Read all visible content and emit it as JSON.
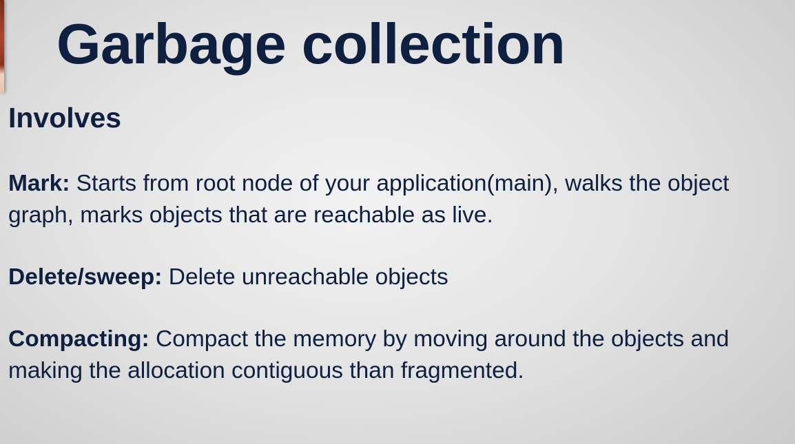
{
  "slide": {
    "title": "Garbage collection",
    "subtitle": "Involves",
    "items": [
      {
        "term": "Mark:",
        "text": " Starts from root node of your application(main), walks the object graph, marks objects that are reachable as live."
      },
      {
        "term": "Delete/sweep:",
        "text": " Delete unreachable objects"
      },
      {
        "term": "Compacting:",
        "text": " Compact the memory by moving around the objects and making the allocation contiguous than fragmented."
      }
    ]
  }
}
